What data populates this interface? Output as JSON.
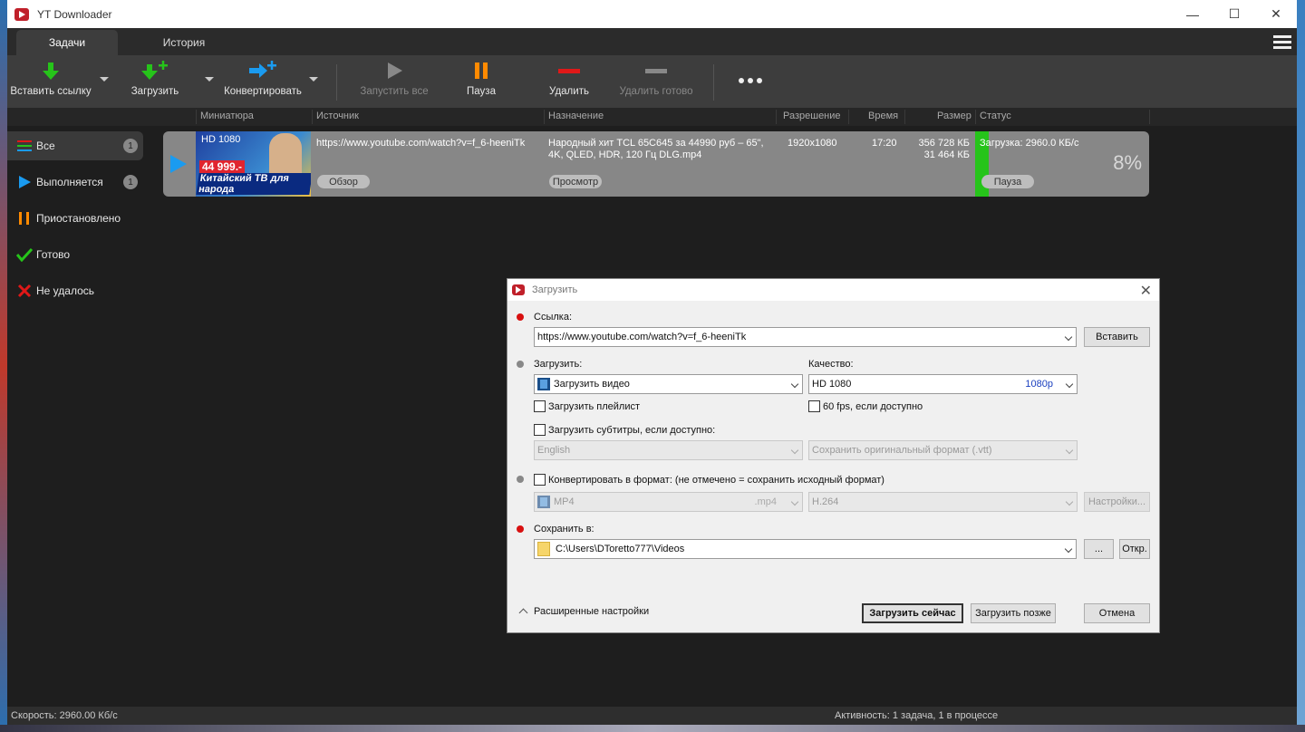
{
  "window": {
    "title": "YT Downloader"
  },
  "tabs": [
    {
      "label": "Задачи"
    },
    {
      "label": "История"
    }
  ],
  "toolbar": {
    "paste_link": "Вставить ссылку",
    "download": "Загрузить",
    "convert": "Конвертировать",
    "start_all": "Запустить все",
    "pause": "Пауза",
    "delete": "Удалить",
    "delete_done": "Удалить готово"
  },
  "columns": {
    "thumbnail": "Миниатюра",
    "source": "Источник",
    "destination": "Назначение",
    "resolution": "Разрешение",
    "time": "Время",
    "size": "Размер",
    "status": "Статус"
  },
  "sidebar": {
    "items": [
      {
        "label": "Все",
        "badge": "1"
      },
      {
        "label": "Выполняется",
        "badge": "1"
      },
      {
        "label": "Приостановлено"
      },
      {
        "label": "Готово"
      },
      {
        "label": "Не удалось"
      }
    ]
  },
  "task": {
    "thumb_hd": "HD 1080",
    "thumb_price": "44 999.-",
    "thumb_caption": "Китайский ТВ для народа",
    "source": "https://www.youtube.com/watch?v=f_6-heeniTk",
    "destination": "Народный хит TCL 65C645 за 44990 руб – 65\", 4K, QLED, HDR, 120 Гц DLG.mp4",
    "resolution": "1920x1080",
    "time": "17:20",
    "size_total": "356 728 КБ",
    "size_done": "31 464 КБ",
    "status": "Загрузка: 2960.0 КБ/с",
    "percent": "8%",
    "progress": 0.08,
    "browse_btn": "Обзор",
    "view_btn": "Просмотр",
    "pause_btn": "Пауза"
  },
  "statusbar": {
    "speed": "Скорость: 2960.00 Кб/с",
    "activity": "Активность: 1 задача, 1 в процессе"
  },
  "dialog": {
    "title": "Загрузить",
    "link_label": "Ссылка:",
    "link_value": "https://www.youtube.com/watch?v=f_6-heeniTk",
    "paste_btn": "Вставить",
    "download_label": "Загрузить:",
    "download_value": "Загрузить видео",
    "quality_label": "Качество:",
    "quality_value": "HD 1080",
    "quality_tag": "1080p",
    "playlist_chk": "Загрузить плейлист",
    "fps_chk": "60 fps, если доступно",
    "subtitles_chk": "Загрузить субтитры, если доступно:",
    "sub_lang": "English",
    "sub_format": "Сохранить оригинальный формат (.vtt)",
    "convert_chk": "Конвертировать в формат: (не отмечено = сохранить исходный формат)",
    "format_value": "MP4",
    "format_ext": ".mp4",
    "codec_value": "H.264",
    "settings_btn": "Настройки...",
    "save_label": "Сохранить в:",
    "save_path": "C:\\Users\\DToretto777\\Videos",
    "browse_btn": "...",
    "open_btn": "Откр.",
    "advanced": "Расширенные настройки",
    "download_now": "Загрузить сейчас",
    "download_later": "Загрузить позже",
    "cancel": "Отмена"
  },
  "colors": {
    "accent_green": "#26c41a",
    "accent_blue": "#1a9bf0",
    "accent_orange": "#ff8a00",
    "accent_red": "#e01818"
  }
}
